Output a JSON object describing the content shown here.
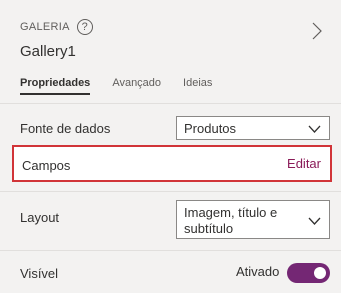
{
  "header": {
    "control_type": "GALERIA",
    "help_icon": "?",
    "control_name": "Gallery1"
  },
  "tabs": [
    {
      "label": "Propriedades",
      "active": true
    },
    {
      "label": "Avançado",
      "active": false
    },
    {
      "label": "Ideias",
      "active": false
    }
  ],
  "properties": {
    "data_source": {
      "label": "Fonte de dados",
      "value": "Produtos"
    },
    "fields": {
      "label": "Campos",
      "action": "Editar"
    },
    "layout": {
      "label": "Layout",
      "value_line1": "Imagem, título e",
      "value_line2": "subtítulo"
    },
    "visible": {
      "label": "Visível",
      "state_label": "Ativado",
      "on": true
    }
  },
  "colors": {
    "highlight_border": "#d13438",
    "accent": "#742774",
    "link": "#8a1b58"
  }
}
